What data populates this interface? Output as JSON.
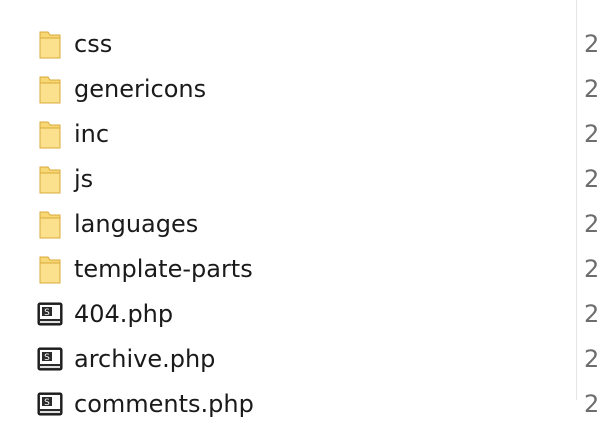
{
  "files": [
    {
      "name": "css",
      "icon": "folder-icon",
      "date": "2"
    },
    {
      "name": "genericons",
      "icon": "folder-icon",
      "date": "2"
    },
    {
      "name": "inc",
      "icon": "folder-icon",
      "date": "2"
    },
    {
      "name": "js",
      "icon": "folder-icon",
      "date": "2"
    },
    {
      "name": "languages",
      "icon": "folder-icon",
      "date": "2"
    },
    {
      "name": "template-parts",
      "icon": "folder-icon",
      "date": "2"
    },
    {
      "name": "404.php",
      "icon": "php-file-icon",
      "date": "2"
    },
    {
      "name": "archive.php",
      "icon": "php-file-icon",
      "date": "2"
    },
    {
      "name": "comments.php",
      "icon": "php-file-icon",
      "date": "2"
    }
  ],
  "colors": {
    "folder_fill": "#f8d775",
    "folder_shade": "#e8b84a",
    "php_icon_bg": "#2b2b2b"
  }
}
